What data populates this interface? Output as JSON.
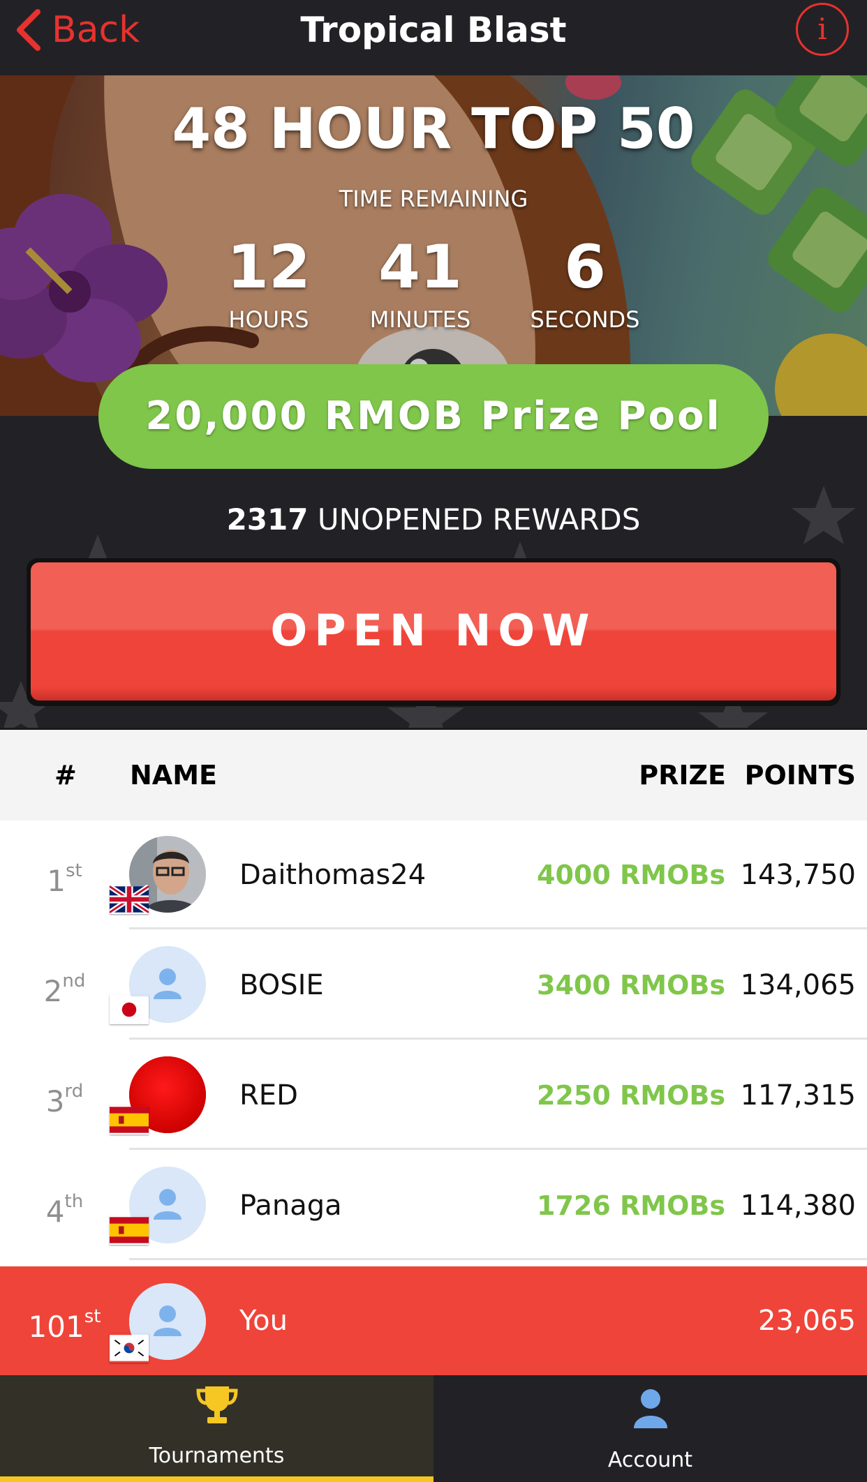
{
  "header": {
    "back_label": "Back",
    "title": "Tropical Blast",
    "info_label": "i"
  },
  "event": {
    "title": "48 HOUR TOP 50",
    "time_remaining_label": "TIME REMAINING",
    "countdown": [
      {
        "value": "12",
        "unit": "HOURS"
      },
      {
        "value": "41",
        "unit": "MINUTES"
      },
      {
        "value": "6",
        "unit": "SECONDS"
      }
    ],
    "prize_pool": "20,000 RMOB Prize Pool",
    "rewards_count": "2317",
    "rewards_label": "UNOPENED REWARDS",
    "open_button": "OPEN NOW"
  },
  "table": {
    "columns": {
      "rank": "#",
      "name": "NAME",
      "prize": "PRIZE",
      "points": "POINTS"
    },
    "rows": [
      {
        "rank": "1",
        "suffix": "st",
        "name": "Daithomas24",
        "prize": "4000 RMOBs",
        "points": "143,750",
        "flag": "uk-flag-icon",
        "avatar": "photo-avatar"
      },
      {
        "rank": "2",
        "suffix": "nd",
        "name": "BOSIE",
        "prize": "3400 RMOBs",
        "points": "134,065",
        "flag": "japan-flag-icon",
        "avatar": "default-avatar"
      },
      {
        "rank": "3",
        "suffix": "rd",
        "name": "RED",
        "prize": "2250 RMOBs",
        "points": "117,315",
        "flag": "spain-flag-icon",
        "avatar": "red-avatar"
      },
      {
        "rank": "4",
        "suffix": "th",
        "name": "Panaga",
        "prize": "1726 RMOBs",
        "points": "114,380",
        "flag": "spain-flag-icon",
        "avatar": "default-avatar"
      }
    ],
    "you": {
      "rank": "101",
      "suffix": "st",
      "name": "You",
      "points": "23,065",
      "flag": "south-korea-flag-icon"
    }
  },
  "tabs": [
    {
      "label": "Tournaments",
      "icon": "trophy-icon",
      "active": true
    },
    {
      "label": "Account",
      "icon": "person-icon",
      "active": false
    }
  ],
  "colors": {
    "accent_red": "#e8322f",
    "prize_green": "#7fc64a",
    "tab_highlight": "#f6c622",
    "bar_dark": "#222226"
  }
}
